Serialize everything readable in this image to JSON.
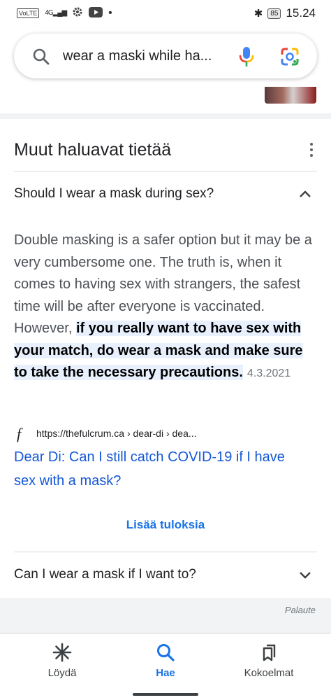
{
  "status_bar": {
    "network": "VoLTE",
    "signal": "4G",
    "battery": "85",
    "time": "15.24"
  },
  "search": {
    "query": "wear a maski while ha..."
  },
  "paa": {
    "title": "Muut haluavat tietää",
    "question1": "Should I wear a mask during sex?",
    "answer_plain": "Double masking is a safer option but it may be a very cumbersome one. The truth is, when it comes to having sex with strangers, the safest time will be after everyone is vaccinated. However, ",
    "answer_highlight": "if you really want to have sex with your match, do wear a mask and make sure to take the necessary precautions.",
    "answer_date": "4.3.2021",
    "source_url": "https://thefulcrum.ca › dear-di › dea...",
    "source_title": "Dear Di: Can I still catch COVID-19 if I have sex with a mask?",
    "more_results": "Lisää tuloksia",
    "question2": "Can I wear a mask if I want to?"
  },
  "feedback": "Palaute",
  "bottom_nav": [
    {
      "label": "Löydä",
      "icon": "asterisk-icon"
    },
    {
      "label": "Hae",
      "icon": "search-icon"
    },
    {
      "label": "Kokoelmat",
      "icon": "bookmarks-icon"
    }
  ],
  "colors": {
    "accent": "#1a73e8",
    "link": "#1558d6",
    "highlight": "#e8f0fe"
  }
}
